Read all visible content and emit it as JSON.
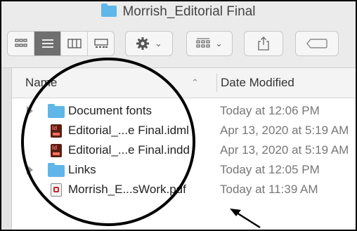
{
  "window": {
    "title": "Morrish_Editorial Final"
  },
  "toolbar": {
    "view_buttons": [
      "icon-view",
      "list-view",
      "column-view",
      "gallery-view"
    ],
    "active_view": "list-view"
  },
  "columns": {
    "name": "Name",
    "date": "Date Modified"
  },
  "files": [
    {
      "name": "Document fonts",
      "date": "Today at 12:06 PM",
      "kind": "folder",
      "disclosure": true
    },
    {
      "name": "Editorial_...e Final.idml",
      "date": "Apr 13, 2020 at 5:19 AM",
      "kind": "idml",
      "disclosure": false
    },
    {
      "name": "Editorial_...e Final.indd",
      "date": "Apr 13, 2020 at 5:19 AM",
      "kind": "indd",
      "disclosure": false
    },
    {
      "name": "Links",
      "date": "Today at 12:05 PM",
      "kind": "folder",
      "disclosure": true
    },
    {
      "name": "Morrish_E...sWork.pdf",
      "date": "Today at 11:39 AM",
      "kind": "pdf",
      "disclosure": false
    }
  ],
  "colors": {
    "folder": "#5fb6e8",
    "indesign": "#5a1f14",
    "annotation": "#000000"
  }
}
